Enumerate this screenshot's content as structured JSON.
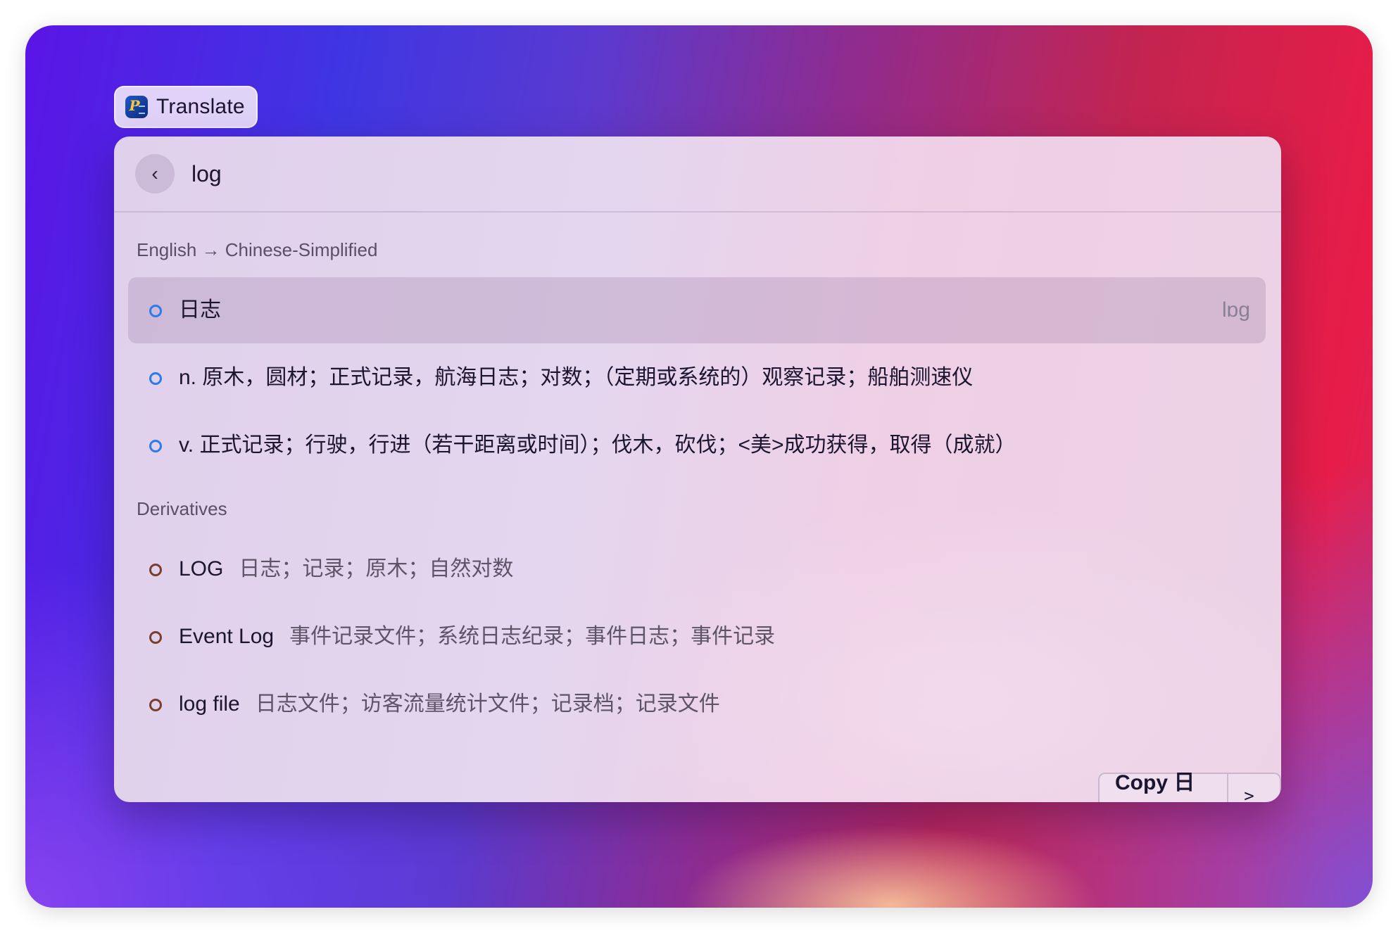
{
  "app": {
    "name": "Translate",
    "icon": "app-icon"
  },
  "search": {
    "query": "log",
    "back_icon": "chevron-left-icon"
  },
  "translation": {
    "section_title": "English → Chinese-Simplified",
    "items": [
      {
        "text": "日志",
        "phonetic": "lɒg",
        "selected": true
      },
      {
        "text": "n. 原木，圆材；正式记录，航海日志；对数；（定期或系统的）观察记录；船舶测速仪"
      },
      {
        "text": "v. 正式记录；行驶，行进（若干距离或时间）；伐木，砍伐；<美>成功获得，取得（成就）"
      }
    ]
  },
  "derivatives": {
    "section_title": "Derivatives",
    "items": [
      {
        "term": "LOG",
        "meaning": "日志；记录；原木；自然对数"
      },
      {
        "term": "Event Log",
        "meaning": "事件记录文件；系统日志纪录；事件日志；事件记录"
      },
      {
        "term": "log file",
        "meaning": "日志文件；访客流量统计文件；记录档；记录文件"
      }
    ]
  },
  "actions": {
    "copy_label": "Copy 日志",
    "actions_shortcut": ">_"
  },
  "colors": {
    "translation_dot": "#2d7be6",
    "derivative_dot": "#7a3e2e"
  }
}
